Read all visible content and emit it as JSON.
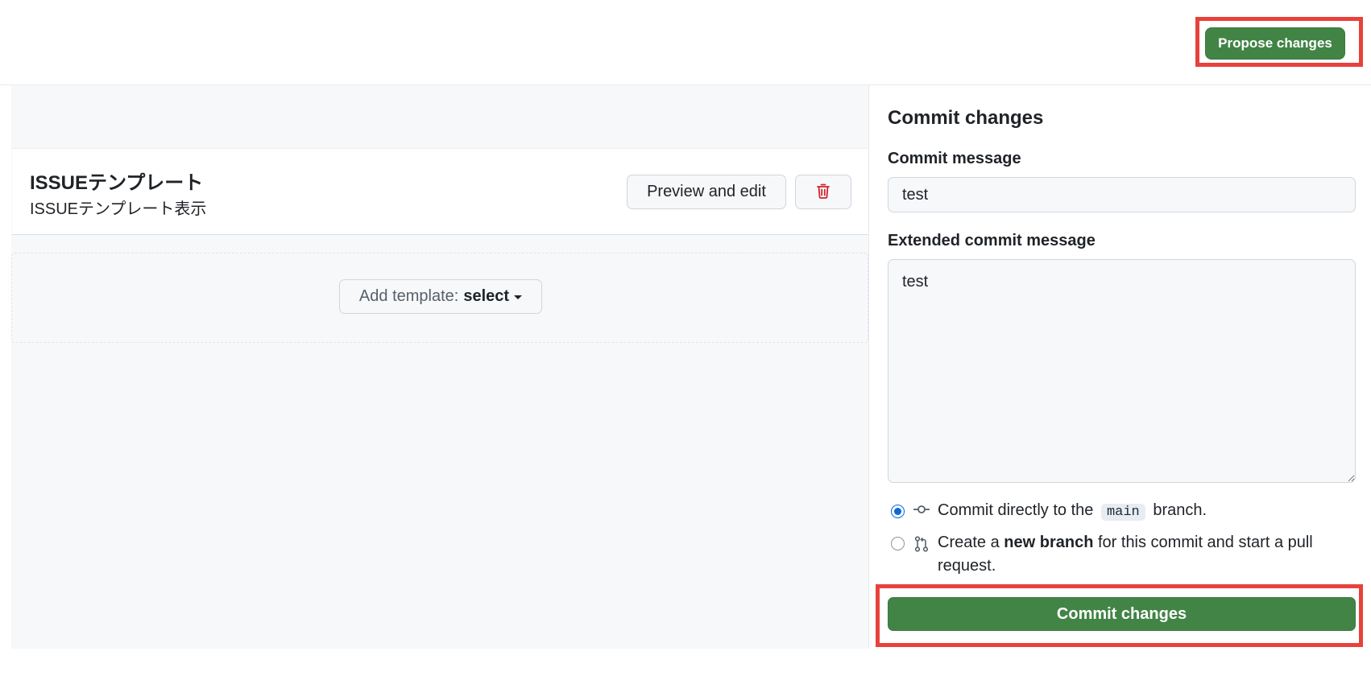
{
  "header": {
    "propose_button": "Propose changes"
  },
  "template_list": {
    "templates": [
      {
        "title": "ISSUEテンプレート",
        "description": "ISSUEテンプレート表示",
        "preview_button": "Preview and edit",
        "delete_icon": "trash-icon"
      }
    ],
    "add_template": {
      "label": "Add template:",
      "value": "select"
    }
  },
  "commit_panel": {
    "title": "Commit changes",
    "commit_message_label": "Commit message",
    "commit_message_value": "test",
    "extended_label": "Extended commit message",
    "extended_value": "test",
    "options": {
      "direct": {
        "prefix": "Commit directly to the",
        "branch": "main",
        "suffix": "branch.",
        "selected": true
      },
      "new_branch": {
        "prefix": "Create a",
        "bold": "new branch",
        "suffix": "for this commit and start a pull request.",
        "selected": false
      }
    },
    "commit_button": "Commit changes"
  },
  "colors": {
    "primary_green": "#428446",
    "highlight_red": "#e8413b",
    "danger_red": "#cf222e",
    "radio_blue": "#0969da"
  }
}
